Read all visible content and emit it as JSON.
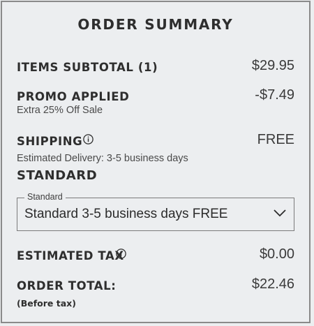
{
  "summary": {
    "title": "ORDER SUMMARY",
    "items_subtotal": {
      "label": "ITEMS SUBTOTAL (1)",
      "value": "$29.95"
    },
    "promo": {
      "label": "PROMO APPLIED",
      "value": "-$7.49",
      "detail": "Extra 25% Off Sale"
    },
    "shipping": {
      "label": "SHIPPING",
      "value": "FREE",
      "estimated_delivery": "Estimated Delivery: 3-5 business days",
      "method_heading": "STANDARD",
      "select": {
        "legend": "Standard",
        "selected": "Standard 3-5 business days FREE"
      }
    },
    "tax": {
      "label": "ESTIMATED TAX",
      "value": "$0.00"
    },
    "total": {
      "label": "ORDER TOTAL:",
      "value": "$22.46",
      "note": "(Before tax)"
    }
  },
  "icons": {
    "shipping_info": "info-icon",
    "tax_info": "info-icon",
    "select_chevron": "chevron-down-icon"
  },
  "colors": {
    "background": "#eceef0",
    "border": "#8a8a8a",
    "text": "#2e2e2e"
  }
}
